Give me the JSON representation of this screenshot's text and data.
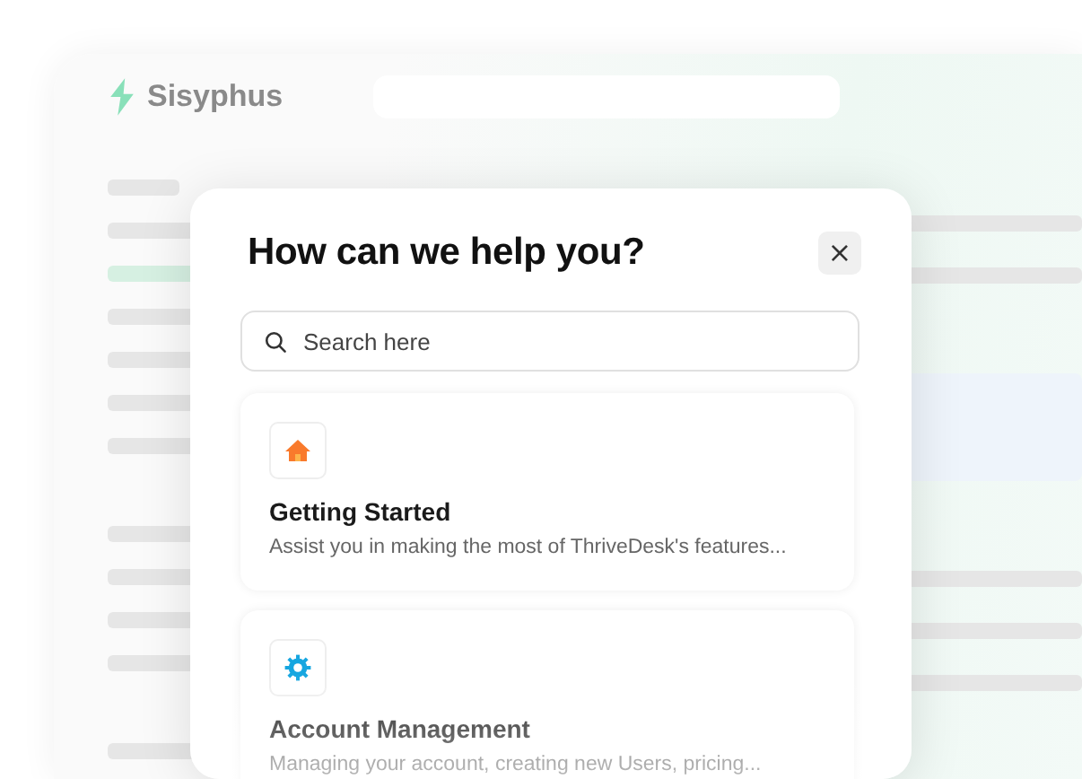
{
  "background": {
    "logo": "Sisyphus"
  },
  "dialog": {
    "title": "How can we help you?",
    "close": "×",
    "search": {
      "placeholder": "Search here"
    },
    "topics": [
      {
        "kind": "home",
        "title": "Getting Started",
        "description": "Assist you in making the most of ThriveDesk's features..."
      },
      {
        "kind": "gear",
        "title": "Account Management",
        "description": "Managing your account, creating new Users, pricing..."
      }
    ]
  }
}
